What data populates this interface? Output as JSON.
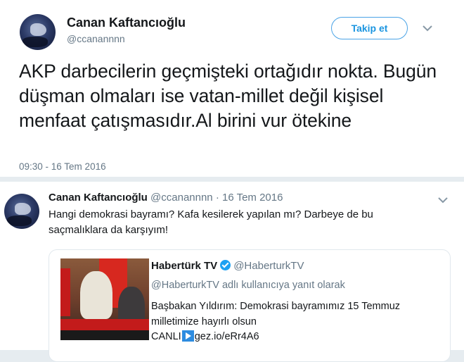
{
  "tweet1": {
    "author_name": "Canan Kaftancıoğlu",
    "author_handle": "@ccanannnn",
    "follow_label": "Takip et",
    "text": "AKP darbecilerin geçmişteki ortağıdır nokta. Bugün düşman olmaları ise vatan-millet değil kişisel menfaat çatışmasıdır.Al birini vur ötekine",
    "timestamp": "09:30 - 16 Tem 2016"
  },
  "tweet2": {
    "author_name": "Canan Kaftancıoğlu",
    "author_handle": "@ccanannnn",
    "separator": "·",
    "date": "16 Tem 2016",
    "text": "Hangi demokrasi bayramı? Kafa kesilerek yapılan mı? Darbeye de bu saçmalıklara da karşıyım!",
    "quoted": {
      "author_name": "Habertürk TV",
      "author_handle": "@HaberturkTV",
      "reply_context": "@HaberturkTV adlı kullanıcıya yanıt olarak",
      "text": "Başbakan Yıldırım: Demokrasi bayramımız 15 Temmuz milletimize hayırlı olsun",
      "live_label": "CANLI",
      "link": "gez.io/eRr4A6"
    }
  },
  "icons": {
    "menu": "chevron-down-icon",
    "verified": "verified-badge-icon",
    "play": "play-icon"
  },
  "colors": {
    "accent": "#1b95e0",
    "secondary_text": "#657786",
    "background": "#e6ecf0"
  }
}
